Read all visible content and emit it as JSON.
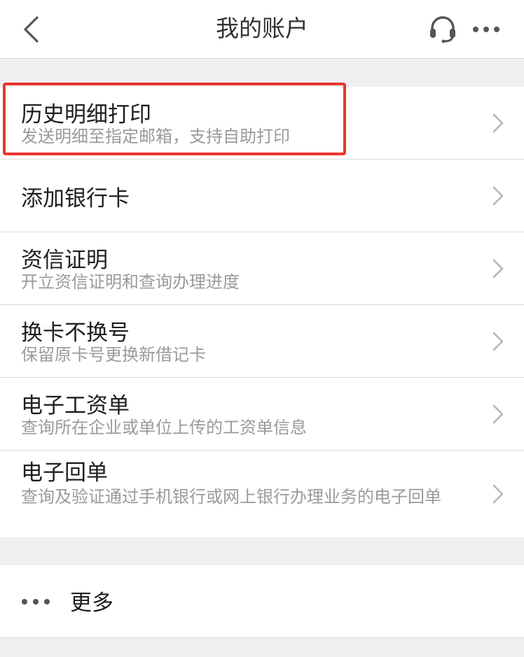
{
  "header": {
    "title": "我的账户"
  },
  "menu": {
    "items": [
      {
        "title": "历史明细打印",
        "subtitle": "发送明细至指定邮箱，支持自助打印"
      },
      {
        "title": "添加银行卡",
        "subtitle": ""
      },
      {
        "title": "资信证明",
        "subtitle": "开立资信证明和查询办理进度"
      },
      {
        "title": "换卡不换号",
        "subtitle": "保留原卡号更换新借记卡"
      },
      {
        "title": "电子工资单",
        "subtitle": "查询所在企业或单位上传的工资单信息"
      },
      {
        "title": "电子回单",
        "subtitle": "查询及验证通过手机银行或网上银行办理业务的电子回单"
      }
    ]
  },
  "more": {
    "label": "更多"
  },
  "icons": {
    "back": "chevron-left-icon",
    "service": "headset-icon",
    "menu": "more-horizontal-icon",
    "row_arrow": "chevron-right-icon",
    "more": "ellipsis-icon"
  },
  "colors": {
    "highlight": "#e8362f",
    "background": "#f0f0f2",
    "subtitle": "#9a9a9a"
  }
}
